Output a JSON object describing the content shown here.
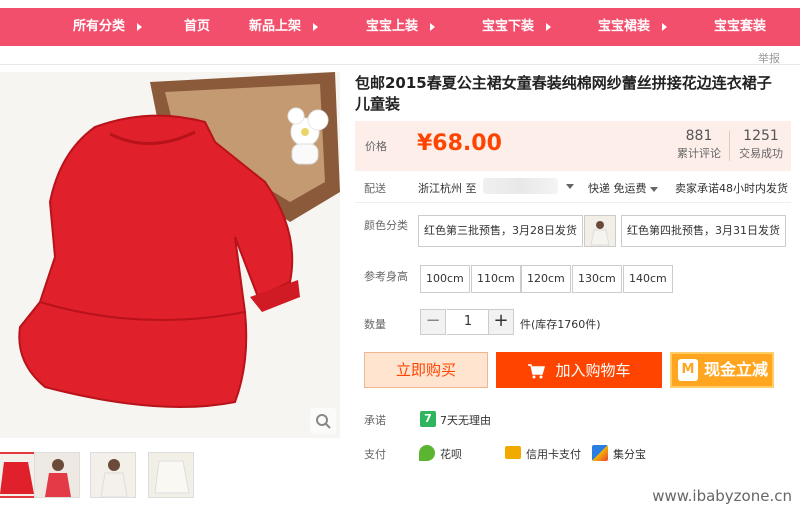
{
  "nav": {
    "items": [
      {
        "label": "所有分类",
        "arrow": true
      },
      {
        "label": "首页",
        "arrow": false
      },
      {
        "label": "新品上架",
        "arrow": true
      },
      {
        "label": "宝宝上装",
        "arrow": true
      },
      {
        "label": "宝宝下装",
        "arrow": true
      },
      {
        "label": "宝宝裙装",
        "arrow": true
      },
      {
        "label": "宝宝套装",
        "arrow": false
      }
    ]
  },
  "report_label": "举报",
  "product": {
    "title": "包邮2015春夏公主裙女童春装纯棉网纱蕾丝拼接花边连衣裙子儿童装",
    "price_label": "价格",
    "price": "¥68.00",
    "reviews_count": "881",
    "reviews_label": "累计评论",
    "sales_count": "1251",
    "sales_label": "交易成功"
  },
  "shipping": {
    "label": "配送",
    "from": "浙江杭州 至",
    "method": "快递 免运费",
    "promise": "卖家承诺48小时内发货"
  },
  "color": {
    "label": "颜色分类",
    "options": [
      "红色第三批预售，3月28日发货",
      "红色第四批预售，3月31日发货"
    ]
  },
  "size": {
    "label": "参考身高",
    "options": [
      "100cm",
      "110cm",
      "120cm",
      "130cm",
      "140cm"
    ]
  },
  "quantity": {
    "label": "数量",
    "value": "1",
    "minus": "−",
    "plus": "+",
    "stock": "件(库存1760件)"
  },
  "actions": {
    "buy_now": "立即购买",
    "add_to_cart": "加入购物车",
    "promo": "现金立减",
    "promo_badge": "M"
  },
  "promise": {
    "label": "承诺",
    "badge": "7",
    "text": "7天无理由"
  },
  "payment": {
    "label": "支付",
    "methods": [
      "花呗",
      "信用卡支付",
      "集分宝"
    ]
  },
  "watermark": "www.ibabyzone.cn",
  "colors": {
    "nav_bg": "#f24f6d",
    "price": "#ff4400",
    "cart_button": "#ff4400",
    "promo_button": "#ffa520",
    "dress_red": "#e0202a"
  }
}
